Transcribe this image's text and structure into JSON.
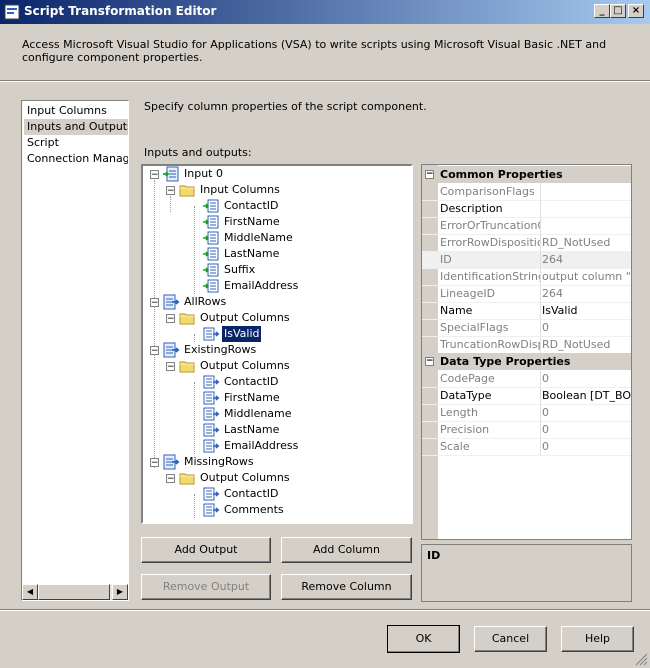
{
  "window": {
    "title": "Script Transformation Editor",
    "minimize": "_",
    "maximize": "□",
    "close": "×"
  },
  "description": "Access Microsoft Visual Studio for Applications (VSA) to write scripts using Microsoft Visual Basic .NET and configure component properties.",
  "nav": {
    "items": [
      "Input Columns",
      "Inputs and Outputs",
      "Script",
      "Connection Managers"
    ],
    "selected": "Inputs and Outputs"
  },
  "instruction": "Specify column properties of the script component.",
  "tree_label": "Inputs and outputs:",
  "tree": {
    "input0": "Input 0",
    "input_columns_folder": "Input Columns",
    "input_columns": [
      "ContactID",
      "FirstName",
      "MiddleName",
      "LastName",
      "Suffix",
      "EmailAddress"
    ],
    "allrows": "AllRows",
    "allrows_folder": "Output Columns",
    "allrows_columns": [
      "IsValid"
    ],
    "existingrows": "ExistingRows",
    "existingrows_folder": "Output Columns",
    "existingrows_columns": [
      "ContactID",
      "FirstName",
      "Middlename",
      "LastName",
      "EmailAddress"
    ],
    "missingrows": "MissingRows",
    "missingrows_folder": "Output Columns",
    "missingrows_columns": [
      "ContactID",
      "Comments"
    ]
  },
  "buttons": {
    "add_output": "Add Output",
    "add_column": "Add Column",
    "remove_output": "Remove Output",
    "remove_column": "Remove Column",
    "ok": "OK",
    "cancel": "Cancel",
    "help": "Help"
  },
  "properties": {
    "common_header": "Common Properties",
    "common": [
      {
        "name": "ComparisonFlags",
        "value": ""
      },
      {
        "name": "Description",
        "value": ""
      },
      {
        "name": "ErrorOrTruncationOperation",
        "value": ""
      },
      {
        "name": "ErrorRowDisposition",
        "value": "RD_NotUsed"
      },
      {
        "name": "ID",
        "value": "264"
      },
      {
        "name": "IdentificationString",
        "value": "output column \"IsValid\""
      },
      {
        "name": "LineageID",
        "value": "264"
      },
      {
        "name": "Name",
        "value": "IsValid"
      },
      {
        "name": "SpecialFlags",
        "value": "0"
      },
      {
        "name": "TruncationRowDisposition",
        "value": "RD_NotUsed"
      }
    ],
    "datatype_header": "Data Type Properties",
    "datatype": [
      {
        "name": "CodePage",
        "value": "0"
      },
      {
        "name": "DataType",
        "value": "Boolean [DT_BOOL]"
      },
      {
        "name": "Length",
        "value": "0"
      },
      {
        "name": "Precision",
        "value": "0"
      },
      {
        "name": "Scale",
        "value": "0"
      }
    ],
    "description_title": "ID"
  }
}
